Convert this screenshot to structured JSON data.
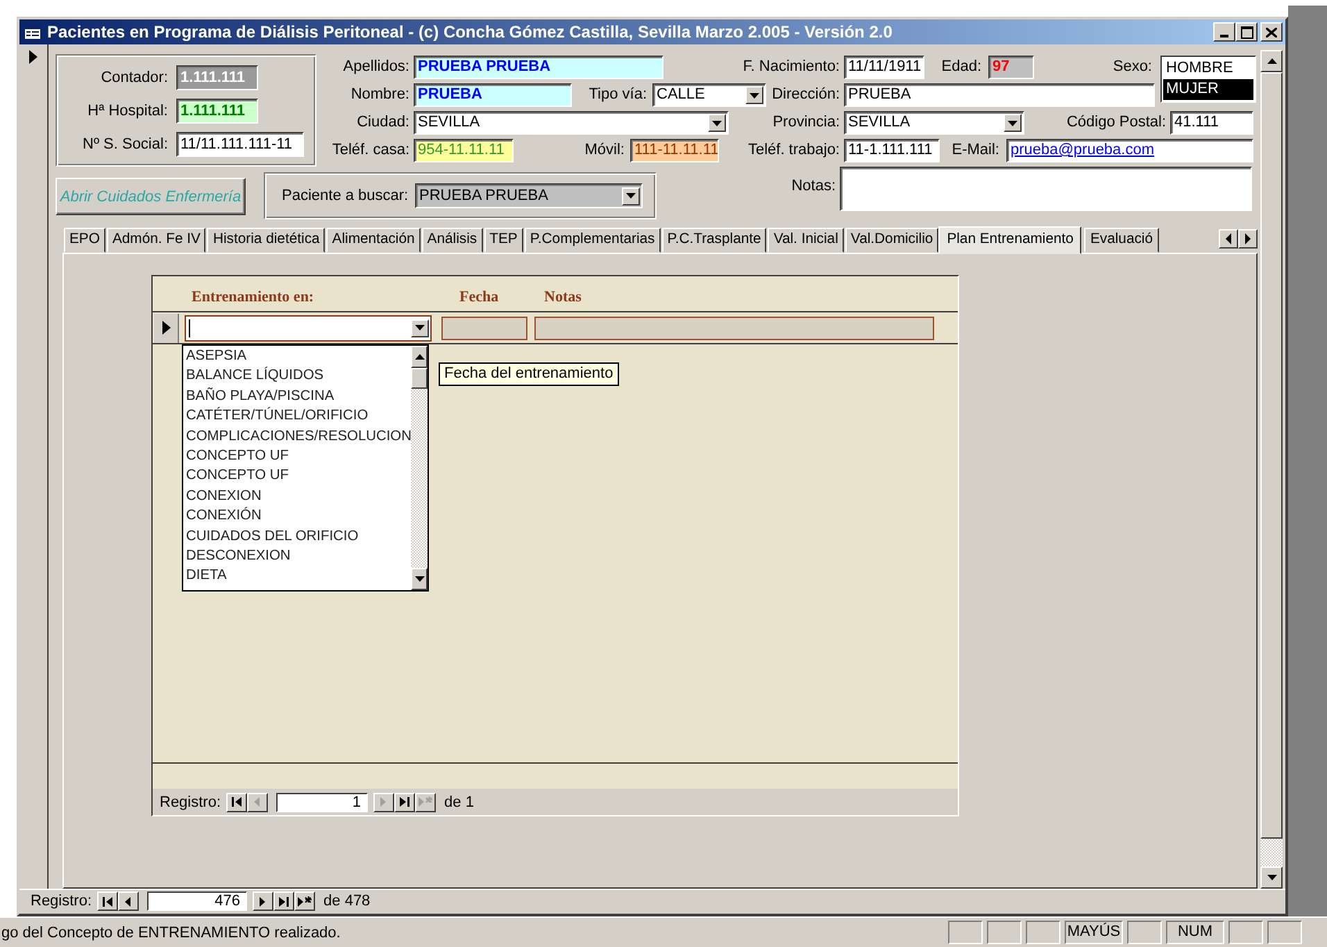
{
  "window": {
    "title": "Pacientes en Programa de Diálisis Peritoneal - (c) Concha Gómez Castilla, Sevilla Marzo 2.005 - Versión 2.0"
  },
  "identity": [
    {
      "label": "Contador:",
      "value": "1.111.111",
      "kind": "readonly"
    },
    {
      "label": "Hª Hospital:",
      "value": "1.111.111",
      "kind": "hospital"
    },
    {
      "label": "Nº S. Social:",
      "value": "11/11.111.111-11",
      "kind": "text"
    }
  ],
  "fields": [
    {
      "label": "Apellidos:",
      "value": "PRUEBA PRUEBA",
      "kind": "name"
    },
    {
      "label": "F. Nacimiento:",
      "value": "11/11/1911",
      "kind": "text"
    },
    {
      "label": "Edad:",
      "value": "97",
      "kind": "age"
    },
    {
      "label": "Nombre:",
      "value": "PRUEBA",
      "kind": "name"
    },
    {
      "label": "Tipo vía:",
      "value": "CALLE",
      "kind": "combo"
    },
    {
      "label": "Dirección:",
      "value": "PRUEBA",
      "kind": "text"
    },
    {
      "label": "Ciudad:",
      "value": "SEVILLA",
      "kind": "combo"
    },
    {
      "label": "Provincia:",
      "value": "SEVILLA",
      "kind": "combo"
    },
    {
      "label": "Código Postal:",
      "value": "41.111",
      "kind": "text"
    },
    {
      "label": "Teléf. casa:",
      "value": "954-11.11.11",
      "kind": "home_phone"
    },
    {
      "label": "Móvil:",
      "value": "111-11.11.11",
      "kind": "mobile"
    },
    {
      "label": "Teléf. trabajo:",
      "value": "11-1.111.111",
      "kind": "text"
    },
    {
      "label": "E-Mail:",
      "value": "prueba@prueba.com",
      "kind": "link"
    },
    {
      "label": "Notas:",
      "kind": "memo"
    }
  ],
  "sexo": {
    "label": "Sexo:",
    "options": [
      {
        "label": "HOMBRE",
        "selected": false
      },
      {
        "label": "MUJER",
        "selected": true
      }
    ]
  },
  "nursing_button": {
    "label": "Abrir Cuidados Enfermería",
    "disabled": true
  },
  "patient_search": {
    "label": "Paciente a buscar:",
    "value": "PRUEBA PRUEBA"
  },
  "tabs": [
    {
      "label": "EPO",
      "selected": false
    },
    {
      "label": "Admón. Fe IV",
      "selected": false
    },
    {
      "label": "Historia dietética",
      "selected": false
    },
    {
      "label": "Alimentación",
      "selected": false
    },
    {
      "label": "Análisis",
      "selected": false
    },
    {
      "label": "TEP",
      "selected": false
    },
    {
      "label": "P.Complementarias",
      "selected": false
    },
    {
      "label": "P.C.Trasplante",
      "selected": false
    },
    {
      "label": "Val. Inicial",
      "selected": false
    },
    {
      "label": "Val.Domicilio",
      "selected": false
    },
    {
      "label": "Plan Entrenamiento",
      "selected": true
    },
    {
      "label": "Evaluació",
      "selected": false
    }
  ],
  "subform": {
    "columns": [
      "Entrenamiento en:",
      "Fecha",
      "Notas"
    ],
    "dropdown": [
      "ASEPSIA",
      "BALANCE LÍQUIDOS",
      "BAÑO PLAYA/PISCINA",
      "CATÉTER/TÚNEL/ORIFICIO",
      "COMPLICACIONES/RESOLUCION",
      "CONCEPTO UF",
      "CONCEPTO UF",
      "CONEXION",
      "CONEXIÓN",
      "CUIDADOS DEL ORIFICIO",
      "DESCONEXION",
      "DIETA"
    ],
    "tooltip": "Fecha del entrenamiento",
    "navigation": {
      "label": "Registro:",
      "current": "1",
      "total": "de 1",
      "buttons": [
        {
          "kind": "first",
          "disabled": false
        },
        {
          "kind": "prev",
          "disabled": true
        },
        {
          "kind": "next",
          "disabled": true
        },
        {
          "kind": "last",
          "disabled": false
        },
        {
          "kind": "new",
          "disabled": true
        }
      ]
    }
  },
  "navigation": {
    "label": "Registro:",
    "current": "476",
    "total": "de 478",
    "buttons": [
      {
        "kind": "first",
        "disabled": false
      },
      {
        "kind": "prev",
        "disabled": false
      },
      {
        "kind": "next",
        "disabled": false
      },
      {
        "kind": "last",
        "disabled": false
      },
      {
        "kind": "new",
        "disabled": false
      }
    ]
  },
  "status_bar": {
    "message": "go del Concepto de ENTRENAMIENTO realizado.",
    "indicators": [
      "MAYÚS",
      "NUM"
    ]
  }
}
